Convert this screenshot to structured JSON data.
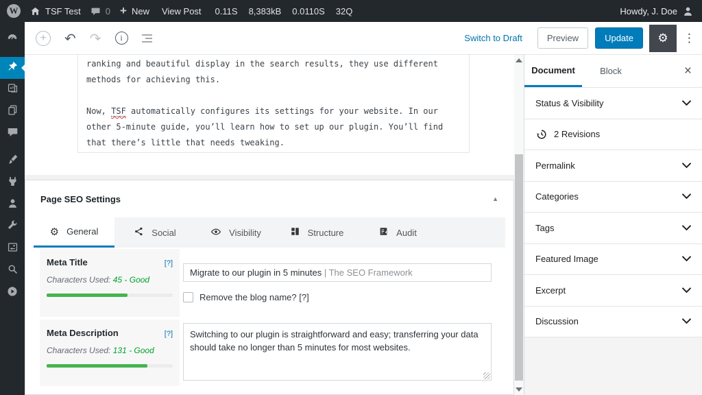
{
  "admin_bar": {
    "site_name": "TSF Test",
    "comments_count": "0",
    "new_label": "New",
    "view_post": "View Post",
    "stats": [
      "0.11S",
      "8,383kB",
      "0.0110S",
      "32Q"
    ],
    "howdy": "Howdy, J. Doe",
    "icons": [
      "wordpress-logo",
      "home",
      "comments-bubble",
      "plus",
      "avatar"
    ]
  },
  "toolbar": {
    "switch_to_draft": "Switch to Draft",
    "preview": "Preview",
    "update": "Update",
    "icons": [
      "inserter-plus",
      "undo",
      "redo",
      "info",
      "list-view",
      "gear",
      "ellipsis"
    ],
    "accent_color": "#007cba"
  },
  "admin_menu_icons": [
    "dashboard-gauge",
    "posts-pin-active",
    "media",
    "pages",
    "comments",
    "appearance-brush",
    "plugins-plug",
    "users-person",
    "tools-wrench",
    "settings-box",
    "search-magnifier",
    "play-circle"
  ],
  "post": {
    "p1": "ranking and beautiful display in the search results, they use different methods for achieving this.",
    "p2_before": "Now, ",
    "p2_link": "TSF",
    "p2_after": " automatically configures its settings for your website. In our other 5-minute guide, you’ll learn how to set up our plugin. You’ll find that there’s little that needs tweaking."
  },
  "seo_box": {
    "title": "Page SEO Settings",
    "tabs": [
      {
        "label": "General",
        "icon": "gear"
      },
      {
        "label": "Social",
        "icon": "share-nodes"
      },
      {
        "label": "Visibility",
        "icon": "eye"
      },
      {
        "label": "Structure",
        "icon": "layout-blocks"
      },
      {
        "label": "Audit",
        "icon": "audit-document"
      }
    ],
    "meta_title": {
      "label": "Meta Title",
      "help": "[?]",
      "chars_label": "Characters Used:",
      "chars_value": "45 - Good",
      "bar_percent": 64,
      "bar_style": "width:64%",
      "value": "Migrate to our plugin in 5 minutes",
      "value_suffix": " | The SEO Framework",
      "checkbox_label": "Remove the blog name? [?]",
      "checkbox_checked": false
    },
    "meta_description": {
      "label": "Meta Description",
      "help": "[?]",
      "chars_label": "Characters Used:",
      "chars_value": "131 - Good",
      "bar_percent": 80,
      "bar_style": "width:80%",
      "value": "Switching to our plugin is straightforward and easy; transferring your data should take no longer than 5 minutes for most websites."
    },
    "colors": {
      "good_text": "#00a32a",
      "bar_fill": "#46b450",
      "active_tab_underline": "#007cba"
    }
  },
  "doc_sidebar": {
    "tab_document": "Document",
    "tab_block": "Block",
    "revisions": "2 Revisions",
    "panels": [
      "Status & Visibility",
      "Permalink",
      "Categories",
      "Tags",
      "Featured Image",
      "Excerpt",
      "Discussion"
    ]
  }
}
